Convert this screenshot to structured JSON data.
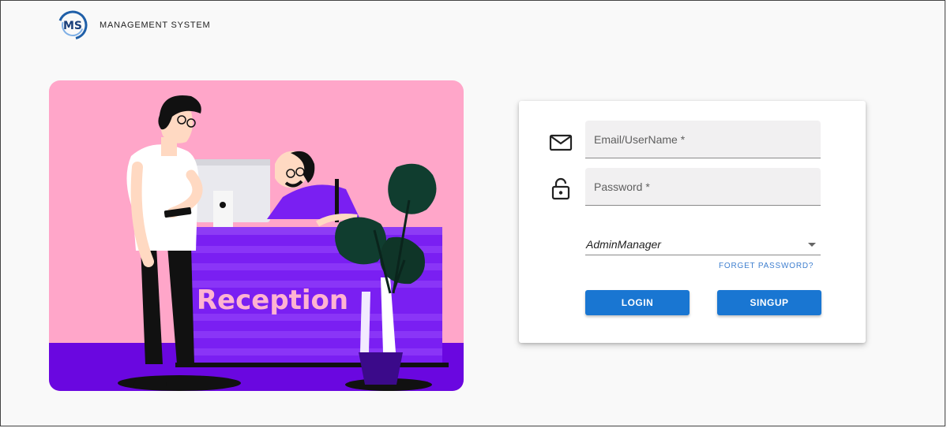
{
  "header": {
    "logo_text": "MS",
    "brand": "MANAGEMENT SYSTEM"
  },
  "illustration": {
    "sign": "Reception"
  },
  "login": {
    "email_placeholder": "Email/UserName *",
    "password_placeholder": "Password *",
    "role_selected": "AdminManager",
    "forgot_label": "FORGET PASSWORD?",
    "login_label": "LOGIN",
    "signup_label": "SINGUP"
  },
  "icons": {
    "email": "mail-icon",
    "password": "lock-open-icon",
    "select": "caret-down-icon"
  },
  "colors": {
    "primary": "#1976d2",
    "link": "#3f7fcf",
    "illustration_bg": "#ffa6c9",
    "desk": "#7a1ff2",
    "floor": "#6a07e0"
  }
}
